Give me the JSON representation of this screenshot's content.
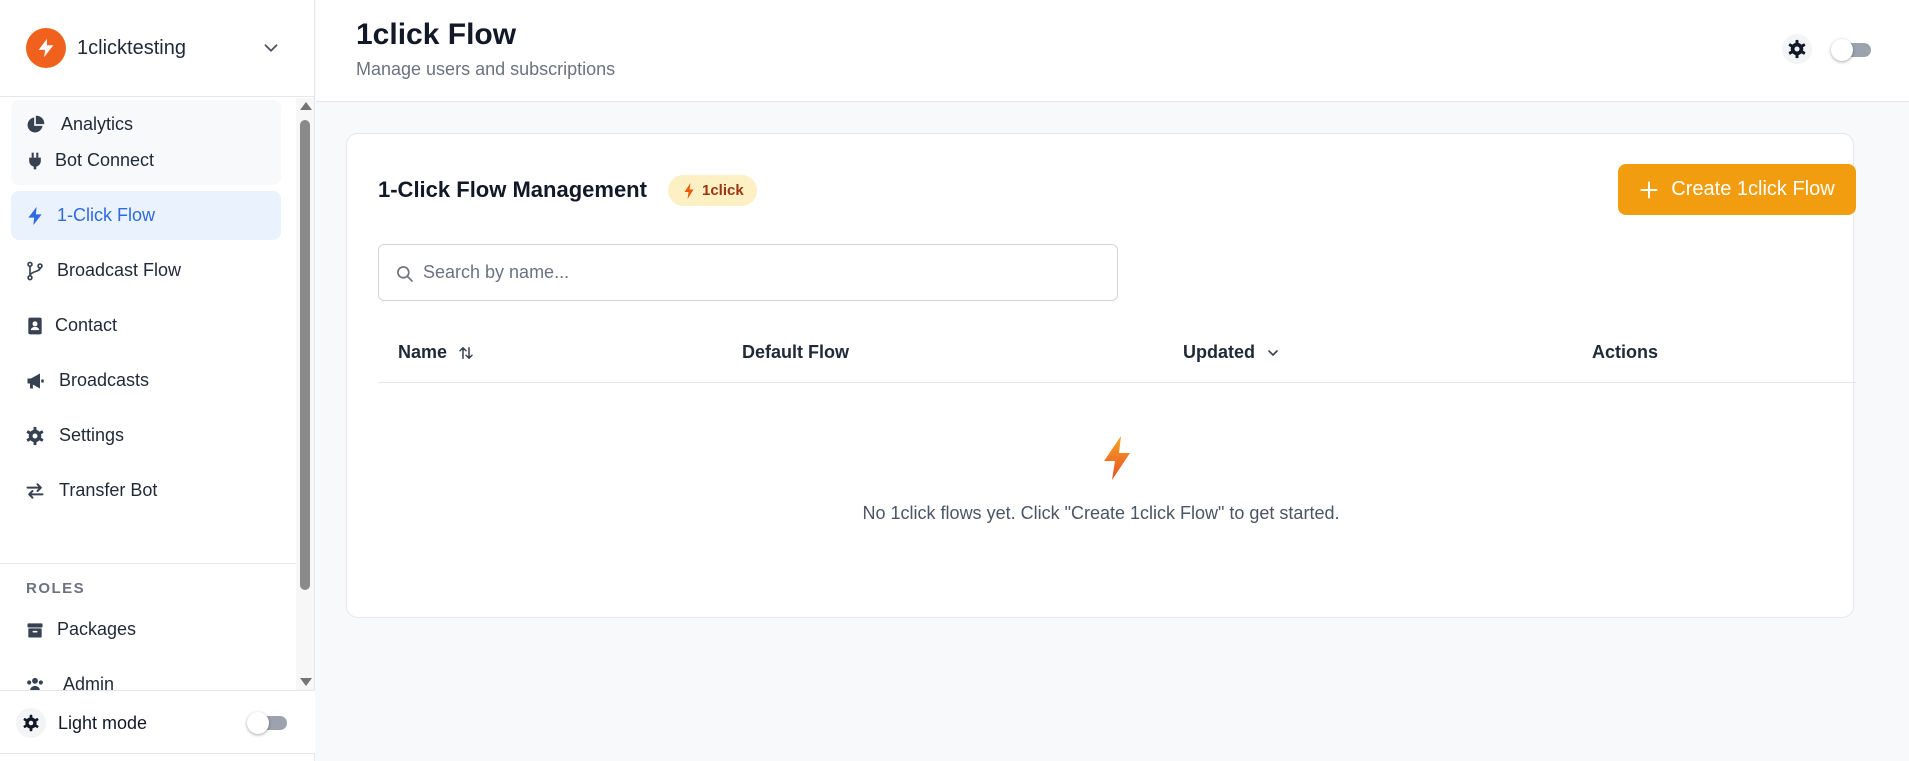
{
  "workspace": {
    "name": "1clicktesting"
  },
  "sidebar": {
    "items": [
      {
        "label": "Analytics",
        "icon": "pie-chart-icon"
      },
      {
        "label": "Bot Connect",
        "icon": "plug-icon"
      },
      {
        "label": "1-Click Flow",
        "icon": "lightning-icon",
        "active": true
      },
      {
        "label": "Broadcast Flow",
        "icon": "git-branch-icon"
      },
      {
        "label": "Contact",
        "icon": "contact-card-icon"
      },
      {
        "label": "Broadcasts",
        "icon": "megaphone-icon"
      },
      {
        "label": "Settings",
        "icon": "gear-icon"
      },
      {
        "label": "Transfer Bot",
        "icon": "transfer-arrows-icon"
      }
    ],
    "roles_heading": "ROLES",
    "role_items": [
      {
        "label": "Packages",
        "icon": "box-icon"
      },
      {
        "label": "Admin",
        "icon": "users-icon"
      }
    ],
    "footer": {
      "label": "Light mode",
      "toggle_on": false
    }
  },
  "header": {
    "title": "1click Flow",
    "subtitle": "Manage users and subscriptions",
    "theme_toggle_on": false
  },
  "main": {
    "card_title": "1-Click Flow Management",
    "badge": "1click",
    "create_button": "Create 1click Flow",
    "search": {
      "placeholder": "Search by name...",
      "value": ""
    },
    "table": {
      "columns": [
        "Name",
        "Default Flow",
        "Updated",
        "Actions"
      ],
      "rows": []
    },
    "empty_state": "No 1click flows yet. Click \"Create 1click Flow\" to get started."
  },
  "colors": {
    "accent": "#f29d0f",
    "logo": "#f0611e",
    "active_nav_bg": "#e9f2fd",
    "active_nav_text": "#2f6ae0",
    "badge_bg": "#fdf0c4"
  }
}
